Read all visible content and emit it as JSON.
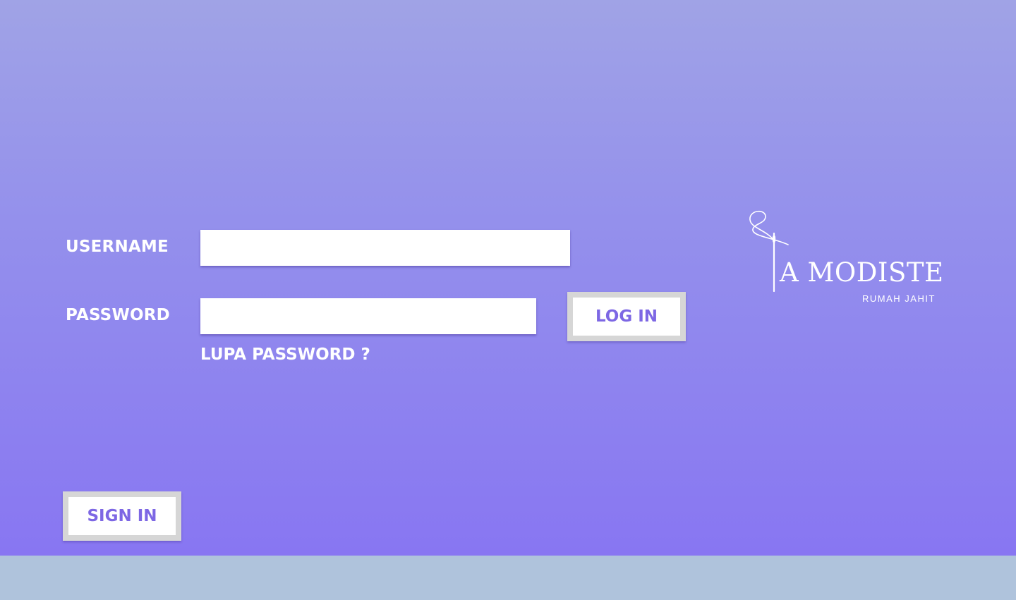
{
  "login_form": {
    "username_label": "USERNAME",
    "username_value": "",
    "password_label": "PASSWORD",
    "password_value": "",
    "forgot_password": "LUPA PASSWORD ?",
    "login_button": "LOG IN",
    "signin_button": "SIGN IN"
  },
  "brand": {
    "logo_icon": "needle-thread-icon",
    "name": "A MODISTE",
    "tagline": "RUMAH JAHIT"
  },
  "colors": {
    "background_top": "#a0a3e6",
    "background_bottom": "#8876f2",
    "accent": "#7d67e4",
    "footer_bar": "#afc3dc"
  }
}
